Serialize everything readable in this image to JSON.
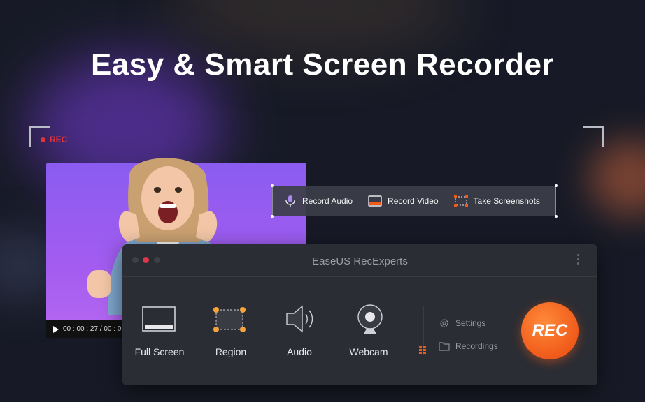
{
  "headline": "Easy & Smart Screen Recorder",
  "rec_indicator": "REC",
  "video": {
    "timecode": "00 : 00 : 27 / 00 : 0"
  },
  "toolbar": {
    "items": [
      {
        "label": "Record Audio",
        "icon": "microphone-icon"
      },
      {
        "label": "Record Video",
        "icon": "video-icon"
      },
      {
        "label": "Take Screenshots",
        "icon": "screenshot-icon"
      }
    ]
  },
  "app": {
    "title": "EaseUS RecExperts",
    "modes": [
      {
        "label": "Full Screen",
        "icon": "fullscreen-icon"
      },
      {
        "label": "Region",
        "icon": "region-icon"
      },
      {
        "label": "Audio",
        "icon": "speaker-icon"
      },
      {
        "label": "Webcam",
        "icon": "webcam-icon"
      }
    ],
    "settings_label": "Settings",
    "recordings_label": "Recordings",
    "rec_button": "REC"
  },
  "colors": {
    "accent": "#f05a1a",
    "rec_red": "#e0333b",
    "video_purple": "#9b5cf0"
  }
}
